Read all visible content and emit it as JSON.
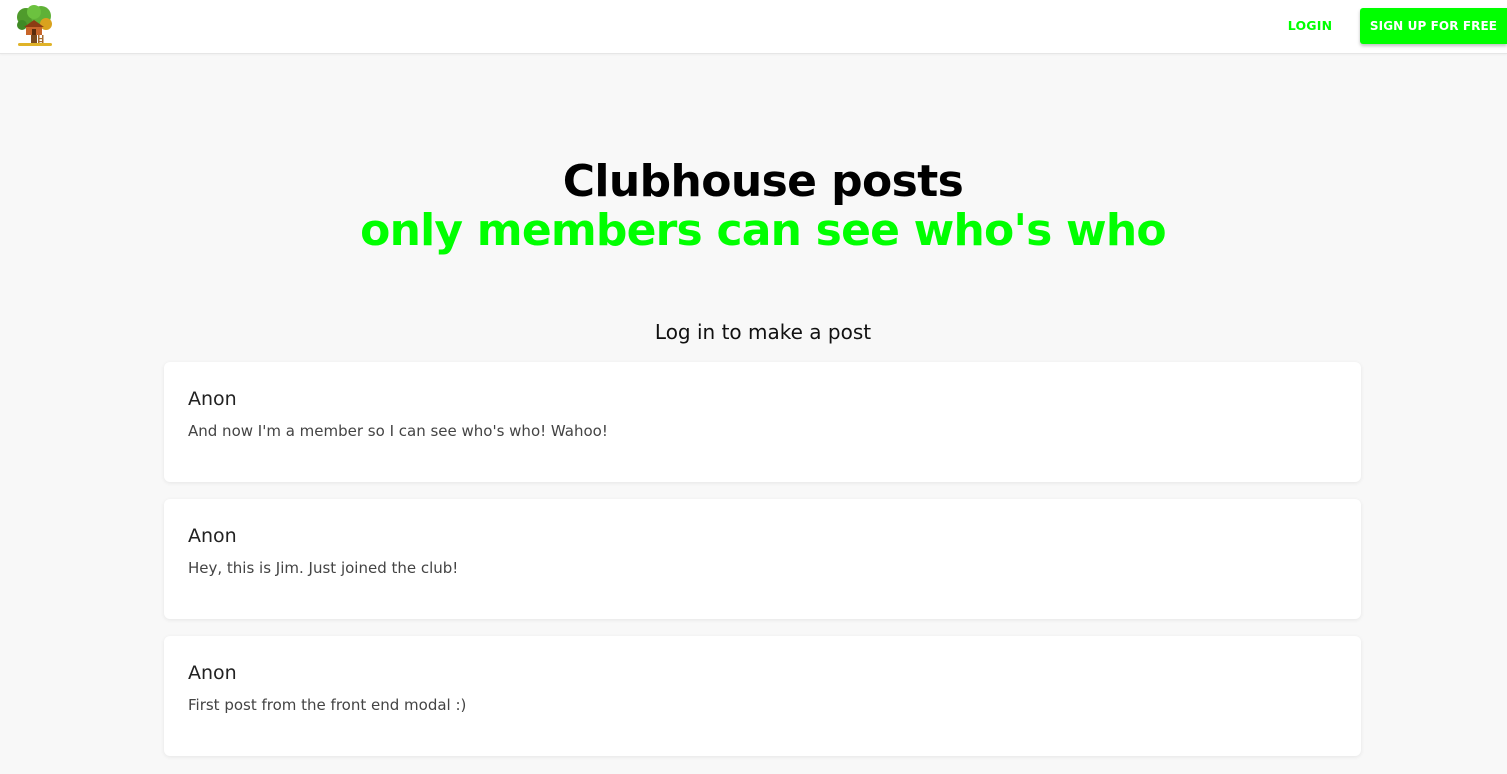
{
  "navbar": {
    "logo_icon": "treehouse-logo-icon",
    "login_label": "LOGIN",
    "signup_label": "SIGN UP FOR FREE"
  },
  "hero": {
    "title": "Clubhouse posts",
    "subtitle": "only members can see who's who"
  },
  "login_prompt": "Log in to make a post",
  "posts": [
    {
      "author": "Anon",
      "body": "And now I'm a member so I can see who's who! Wahoo!"
    },
    {
      "author": "Anon",
      "body": "Hey, this is Jim. Just joined the club!"
    },
    {
      "author": "Anon",
      "body": "First post from the front end modal :)"
    }
  ],
  "colors": {
    "accent": "#00ff00",
    "background": "#f8f8f8",
    "card": "#ffffff"
  }
}
